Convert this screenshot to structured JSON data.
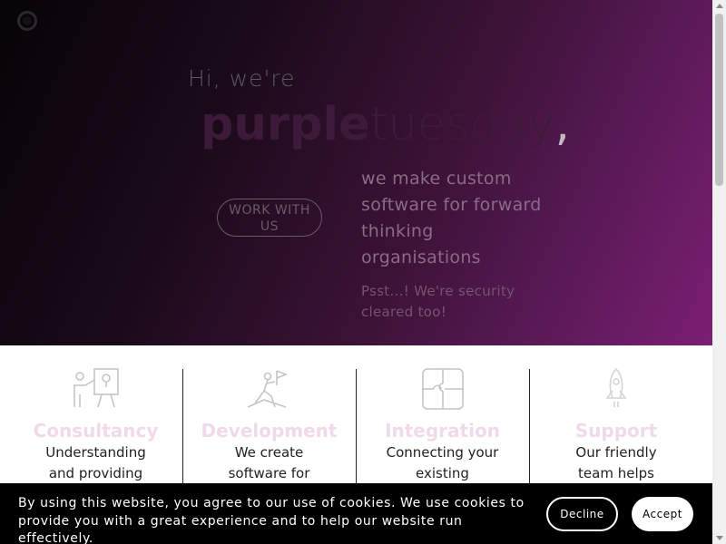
{
  "hero": {
    "greeting": "Hi, we're",
    "brand_bold": "purple",
    "brand_light": "tuesday",
    "brand_comma": ",",
    "cta_label": "WORK WITH US",
    "tagline": "we make custom software for forward thinking organisations",
    "note": "Psst...! We're security cleared too!"
  },
  "services": [
    {
      "title": "Consultancy",
      "desc": "Understanding and providing",
      "icon": "presentation-icon"
    },
    {
      "title": "Development",
      "desc": "We create software for",
      "icon": "climber-flag-icon"
    },
    {
      "title": "Integration",
      "desc": "Connecting your existing",
      "icon": "puzzle-icon"
    },
    {
      "title": "Support",
      "desc": "Our friendly team helps",
      "icon": "rocket-icon"
    }
  ],
  "cookie": {
    "text": "By using this website, you agree to our use of cookies. We use cookies to provide you with a great experience and to help our website run effectively.",
    "decline_label": "Decline",
    "accept_label": "Accept"
  },
  "colors": {
    "accent": "#7b1e74",
    "hero_dark": "#070308",
    "service_title": "#efd9ea",
    "cookie_bg": "#000000"
  }
}
